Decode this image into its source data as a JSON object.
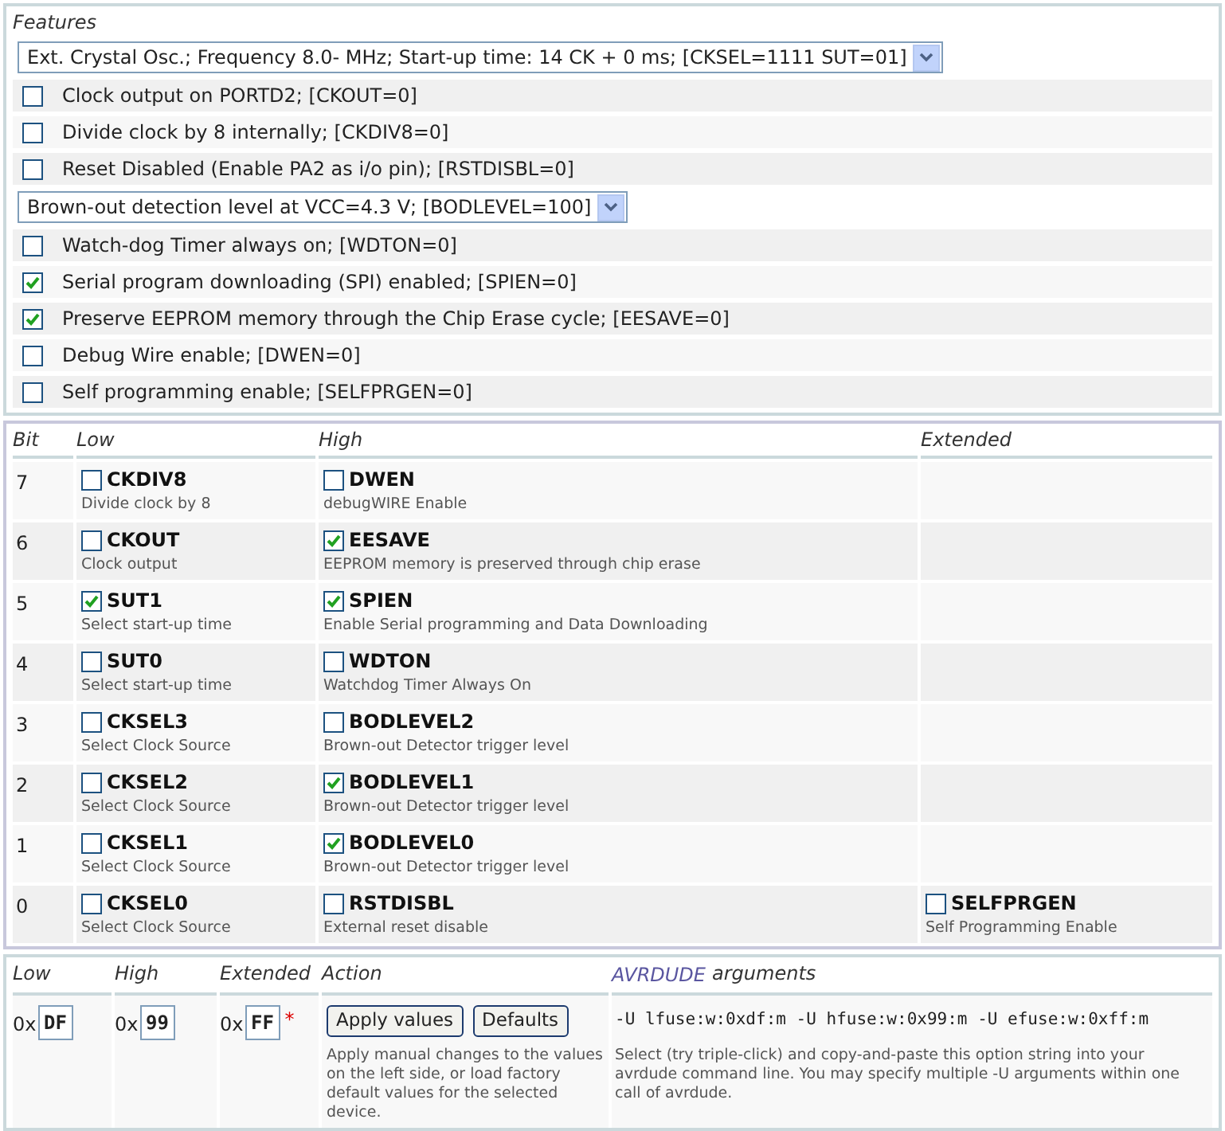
{
  "features": {
    "title": "Features",
    "items": [
      {
        "kind": "select",
        "value": "Ext. Crystal Osc.; Frequency 8.0- MHz; Start-up time: 14 CK + 0 ms; [CKSEL=1111 SUT=01]"
      },
      {
        "kind": "checkbox",
        "label": "Clock output on PORTD2; [CKOUT=0]",
        "checked": false
      },
      {
        "kind": "checkbox",
        "label": "Divide clock by 8 internally; [CKDIV8=0]",
        "checked": false
      },
      {
        "kind": "checkbox",
        "label": "Reset Disabled (Enable PA2 as i/o pin); [RSTDISBL=0]",
        "checked": false
      },
      {
        "kind": "select",
        "value": "Brown-out detection level at VCC=4.3 V; [BODLEVEL=100]"
      },
      {
        "kind": "checkbox",
        "label": "Watch-dog Timer always on; [WDTON=0]",
        "checked": false
      },
      {
        "kind": "checkbox",
        "label": "Serial program downloading (SPI) enabled; [SPIEN=0]",
        "checked": true
      },
      {
        "kind": "checkbox",
        "label": "Preserve EEPROM memory through the Chip Erase cycle; [EESAVE=0]",
        "checked": true
      },
      {
        "kind": "checkbox",
        "label": "Debug Wire enable; [DWEN=0]",
        "checked": false
      },
      {
        "kind": "checkbox",
        "label": "Self programming enable; [SELFPRGEN=0]",
        "checked": false
      }
    ]
  },
  "fuse_table": {
    "columns": [
      "Bit",
      "Low",
      "High",
      "Extended"
    ],
    "rows": [
      {
        "bit": "7",
        "low": {
          "name": "CKDIV8",
          "description": "Divide clock by 8",
          "checked": false
        },
        "high": {
          "name": "DWEN",
          "description": "debugWIRE Enable",
          "checked": false
        }
      },
      {
        "bit": "6",
        "low": {
          "name": "CKOUT",
          "description": "Clock output",
          "checked": false
        },
        "high": {
          "name": "EESAVE",
          "description": "EEPROM memory is preserved through chip erase",
          "checked": true
        }
      },
      {
        "bit": "5",
        "low": {
          "name": "SUT1",
          "description": "Select start-up time",
          "checked": true
        },
        "high": {
          "name": "SPIEN",
          "description": "Enable Serial programming and Data Downloading",
          "checked": true
        }
      },
      {
        "bit": "4",
        "low": {
          "name": "SUT0",
          "description": "Select start-up time",
          "checked": false
        },
        "high": {
          "name": "WDTON",
          "description": "Watchdog Timer Always On",
          "checked": false
        }
      },
      {
        "bit": "3",
        "low": {
          "name": "CKSEL3",
          "description": "Select Clock Source",
          "checked": false
        },
        "high": {
          "name": "BODLEVEL2",
          "description": "Brown-out Detector trigger level",
          "checked": false
        }
      },
      {
        "bit": "2",
        "low": {
          "name": "CKSEL2",
          "description": "Select Clock Source",
          "checked": false
        },
        "high": {
          "name": "BODLEVEL1",
          "description": "Brown-out Detector trigger level",
          "checked": true
        }
      },
      {
        "bit": "1",
        "low": {
          "name": "CKSEL1",
          "description": "Select Clock Source",
          "checked": false
        },
        "high": {
          "name": "BODLEVEL0",
          "description": "Brown-out Detector trigger level",
          "checked": true
        }
      },
      {
        "bit": "0",
        "low": {
          "name": "CKSEL0",
          "description": "Select Clock Source",
          "checked": false
        },
        "high": {
          "name": "RSTDISBL",
          "description": "External reset disable",
          "checked": false
        },
        "extended": {
          "name": "SELFPRGEN",
          "description": "Self Programming Enable",
          "checked": false
        }
      }
    ]
  },
  "manual": {
    "columns": [
      "Low",
      "High",
      "Extended",
      "Action"
    ],
    "fields": [
      {
        "prefix": "0x",
        "value": "DF"
      },
      {
        "prefix": "0x",
        "value": "99"
      },
      {
        "prefix": "0x",
        "value": "FF",
        "mark": "*"
      }
    ],
    "buttons": [
      "Apply values",
      "Defaults"
    ],
    "action_help": "Apply manual changes to the values on the left side, or load factory default values for the selected device.",
    "avrdude": {
      "link": "AVRDUDE",
      "title_rest": "arguments",
      "command": "-U lfuse:w:0xdf:m -U hfuse:w:0x99:m -U efuse:w:0xff:m",
      "help": "Select (try triple-click) and copy-and-paste this option string into your avrdude command line. You may specify multiple -U arguments within one call of avrdude."
    }
  }
}
